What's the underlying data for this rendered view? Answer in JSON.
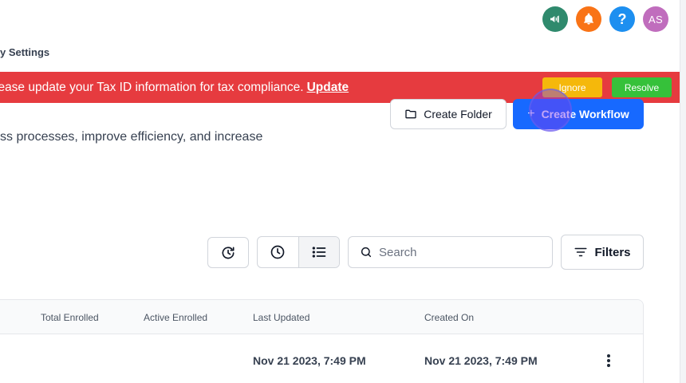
{
  "header": {
    "icons": [
      "megaphone-icon",
      "bell-icon",
      "help-icon"
    ],
    "help_glyph": "?",
    "avatar_initials": "AS",
    "breadcrumb": "y Settings"
  },
  "banner": {
    "message": "lease update your Tax ID information for tax compliance.",
    "link": "Update",
    "ignore_label": "Ignore",
    "resolve_label": "Resolve"
  },
  "actions": {
    "create_folder": "Create Folder",
    "create_workflow": "Create Workflow",
    "plus_glyph": "+"
  },
  "description": "ss processes, improve efficiency, and increase",
  "toolbar": {
    "search_placeholder": "Search",
    "filters_label": "Filters"
  },
  "table": {
    "columns": [
      "Total Enrolled",
      "Active Enrolled",
      "Last Updated",
      "Created On"
    ],
    "rows": [
      {
        "total_enrolled": "",
        "active_enrolled": "",
        "last_updated": "Nov 21 2023, 7:49 PM",
        "created_on": "Nov 21 2023, 7:49 PM"
      }
    ]
  },
  "colors": {
    "banner": "#e63b3f",
    "primary": "#1769ff",
    "ignore": "#f5b80b",
    "resolve": "#36c13a",
    "announce": "#2f8a6d",
    "bell": "#f97316",
    "help": "#1d8ff0",
    "avatar": "#c06dbd"
  }
}
